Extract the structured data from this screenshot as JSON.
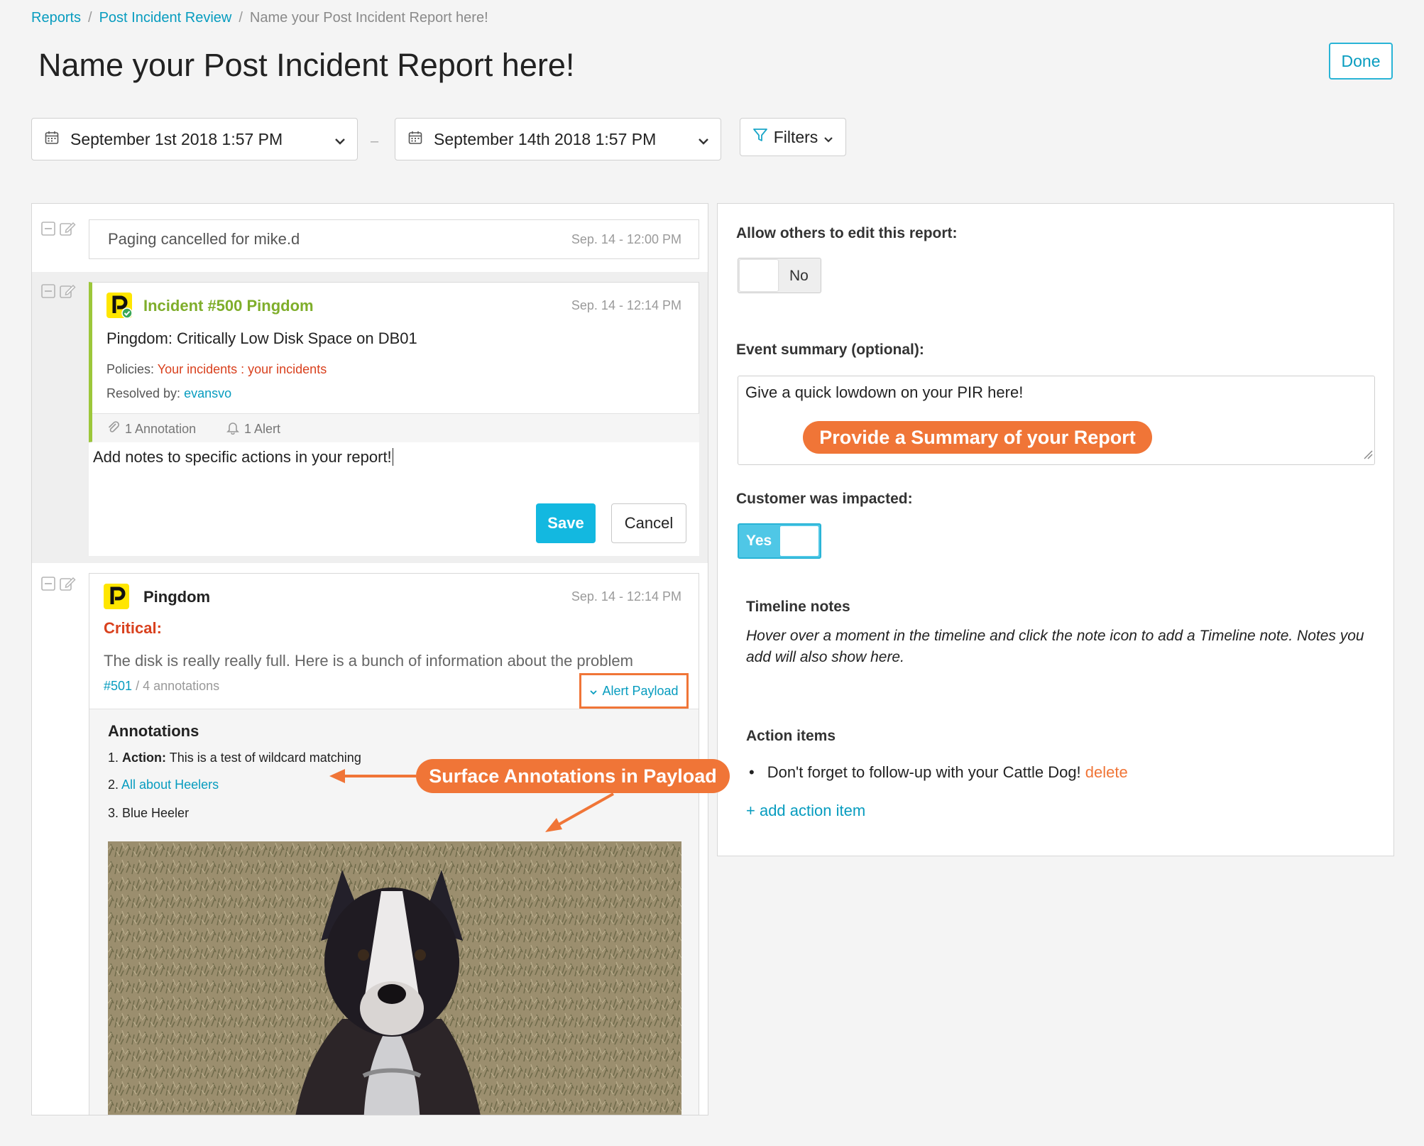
{
  "breadcrumb": {
    "items": [
      "Reports",
      "Post Incident Review"
    ],
    "current": "Name your Post Incident Report here!",
    "separator": "/"
  },
  "page": {
    "title": "Name your Post Incident Report here!",
    "done_label": "Done"
  },
  "date_range": {
    "start": "September 1st 2018 1:57 PM",
    "end": "September 14th 2018 1:57 PM",
    "separator": "–"
  },
  "filters": {
    "label": "Filters"
  },
  "timeline": {
    "paging": {
      "text": "Paging cancelled for mike.d",
      "time": "Sep. 14 - 12:00 PM"
    },
    "incident": {
      "title": "Incident #500 Pingdom",
      "time": "Sep. 14 - 12:14 PM",
      "summary": "Pingdom: Critically Low Disk Space on DB01",
      "policies_label": "Policies:",
      "policies_value": "Your incidents : your incidents",
      "resolved_label": "Resolved by:",
      "resolved_value": "evansvo",
      "annotation_count": "1 Annotation",
      "alert_count": "1 Alert",
      "note_text": "Add notes to specific actions in your report!",
      "save_label": "Save",
      "cancel_label": "Cancel"
    },
    "alert": {
      "source": "Pingdom",
      "time": "Sep. 14 - 12:14 PM",
      "severity": "Critical:",
      "message": "The disk is really really full. Here is a bunch of information about the problem",
      "id_link": "#501",
      "annotations_count": "/ 4 annotations",
      "payload_label": "Alert Payload",
      "annotations_heading": "Annotations",
      "annotation1_num": "1.",
      "annotation1_bold": "Action:",
      "annotation1_text": "This is a test of wildcard matching",
      "annotation2_num": "2.",
      "annotation2_link": "All about Heelers",
      "annotation3": "3. Blue Heeler"
    }
  },
  "settings": {
    "allow_edit_label": "Allow others to edit this report:",
    "allow_edit_value": "No",
    "summary_label": "Event summary (optional):",
    "summary_text": "Give a quick lowdown on your PIR here!",
    "customer_label": "Customer was impacted:",
    "customer_value": "Yes",
    "timeline_notes_heading": "Timeline notes",
    "timeline_notes_text": "Hover over a moment in the timeline and click the note icon to add a Timeline note. Notes you add will also show here.",
    "action_items_heading": "Action items",
    "action_item_1": "Don't forget to follow-up with your Cattle Dog!",
    "delete_label": "delete",
    "add_action_label": "+ add action item"
  },
  "callouts": {
    "summary": "Provide a Summary of your Report",
    "annotations": "Surface Annotations in Payload"
  },
  "colors": {
    "accent": "#079cbf",
    "callout": "#f07537",
    "incident_green": "#7fae2b",
    "critical_red": "#d9411e",
    "pingdom_yellow": "#ffe600"
  }
}
